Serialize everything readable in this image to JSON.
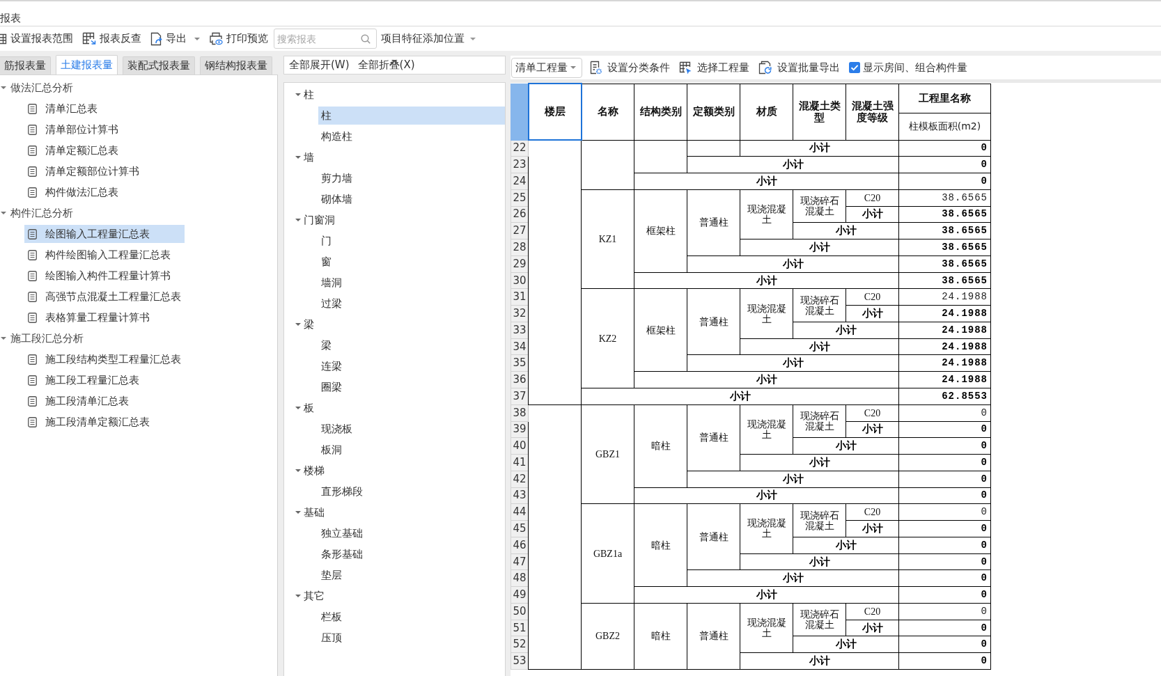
{
  "window": {
    "title": "报表"
  },
  "toolbar": {
    "items": [
      {
        "kind": "button",
        "label": "设置报表范围"
      },
      {
        "kind": "button",
        "label": "报表反查"
      },
      {
        "kind": "menu_button",
        "label": "导出"
      },
      {
        "kind": "button",
        "label": "打印预览"
      },
      {
        "kind": "search",
        "placeholder": "搜索报表"
      },
      {
        "kind": "dropdown",
        "label": "项目特征添加位置"
      }
    ]
  },
  "report_tabs": [
    {
      "label": "筋报表量",
      "selected": false
    },
    {
      "label": "土建报表量",
      "selected": true
    },
    {
      "label": "装配式报表量",
      "selected": false
    },
    {
      "label": "钢结构报表量",
      "selected": false
    }
  ],
  "report_tree": [
    {
      "label": "做法汇总分析",
      "expanded": true,
      "children": [
        {
          "label": "清单汇总表",
          "selected": false
        },
        {
          "label": "清单部位计算书",
          "selected": false
        },
        {
          "label": "清单定额汇总表",
          "selected": false
        },
        {
          "label": "清单定额部位计算书",
          "selected": false
        },
        {
          "label": "构件做法汇总表",
          "selected": false
        }
      ]
    },
    {
      "label": "构件汇总分析",
      "expanded": true,
      "children": [
        {
          "label": "绘图输入工程量汇总表",
          "selected": true
        },
        {
          "label": "构件绘图输入工程量汇总表",
          "selected": false
        },
        {
          "label": "绘图输入构件工程量计算书",
          "selected": false
        },
        {
          "label": "高强节点混凝土工程量汇总表",
          "selected": false
        },
        {
          "label": "表格算量工程量计算书",
          "selected": false
        }
      ]
    },
    {
      "label": "施工段汇总分析",
      "expanded": true,
      "children": [
        {
          "label": "施工段结构类型工程量汇总表",
          "selected": false
        },
        {
          "label": "施工段工程量汇总表",
          "selected": false
        },
        {
          "label": "施工段清单汇总表",
          "selected": false
        },
        {
          "label": "施工段清单定额汇总表",
          "selected": false
        }
      ]
    }
  ],
  "component_panel": {
    "actions": [
      "全部展开(W)",
      "全部折叠(X)"
    ],
    "tree": [
      {
        "label": "柱",
        "expanded": true,
        "children": [
          {
            "label": "柱",
            "selected": true
          },
          {
            "label": "构造柱",
            "selected": false
          }
        ]
      },
      {
        "label": "墙",
        "expanded": true,
        "children": [
          {
            "label": "剪力墙",
            "selected": false
          },
          {
            "label": "砌体墙",
            "selected": false
          }
        ]
      },
      {
        "label": "门窗洞",
        "expanded": true,
        "children": [
          {
            "label": "门",
            "selected": false
          },
          {
            "label": "窗",
            "selected": false
          },
          {
            "label": "墙洞",
            "selected": false
          },
          {
            "label": "过梁",
            "selected": false
          }
        ]
      },
      {
        "label": "梁",
        "expanded": true,
        "children": [
          {
            "label": "梁",
            "selected": false
          },
          {
            "label": "连梁",
            "selected": false
          },
          {
            "label": "圈梁",
            "selected": false
          }
        ]
      },
      {
        "label": "板",
        "expanded": true,
        "children": [
          {
            "label": "现浇板",
            "selected": false
          },
          {
            "label": "板洞",
            "selected": false
          }
        ]
      },
      {
        "label": "楼梯",
        "expanded": true,
        "children": [
          {
            "label": "直形梯段",
            "selected": false
          }
        ]
      },
      {
        "label": "基础",
        "expanded": true,
        "children": [
          {
            "label": "独立基础",
            "selected": false
          },
          {
            "label": "条形基础",
            "selected": false
          },
          {
            "label": "垫层",
            "selected": false
          }
        ]
      },
      {
        "label": "其它",
        "expanded": true,
        "children": [
          {
            "label": "栏板",
            "selected": false
          },
          {
            "label": "压顶",
            "selected": false
          }
        ]
      }
    ]
  },
  "quantity_toolbar": {
    "mode": {
      "value": "清单工程量"
    },
    "buttons": [
      "设置分类条件",
      "选择工程量",
      "设置批量导出"
    ],
    "show_rooms": {
      "label": "显示房间、组合构件量",
      "checked": true
    }
  },
  "table": {
    "columns": [
      {
        "label": "楼层",
        "selected": true
      },
      {
        "label": "名称",
        "selected": false
      },
      {
        "label": "结构类别",
        "selected": false
      },
      {
        "label": "定额类别",
        "selected": false
      },
      {
        "label": "材质",
        "selected": false
      },
      {
        "label": "混凝土类型",
        "selected": false
      },
      {
        "label": "混凝土强度等级",
        "selected": false
      }
    ],
    "quantity_header": "工程里名称",
    "quantity_column": "柱模板面积(m2)",
    "row_numbers": [
      "22",
      "23",
      "24",
      "25",
      "26",
      "27",
      "28",
      "29",
      "30",
      "31",
      "32",
      "33",
      "34",
      "35",
      "36",
      "37",
      "38",
      "39",
      "40",
      "41",
      "42",
      "43",
      "44",
      "45",
      "46",
      "47",
      "48",
      "49",
      "50",
      "51",
      "52",
      "53"
    ],
    "groups": [
      {
        "children": [
          {
            "children": [
              {
                "children": [
                  {
                    "subtotal": {
                      "label": "小计",
                      "value": "0"
                    }
                  }
                ],
                "subtotal": {
                  "label": "小计",
                  "value": "0"
                }
              }
            ],
            "subtotal": {
              "label": "小计",
              "value": "0"
            }
          },
          {
            "text": "KZ1",
            "children": [
              {
                "text": "框架柱",
                "children": [
                  {
                    "text": "普通柱",
                    "children": [
                      {
                        "text": "现浇混凝土",
                        "children": [
                          {
                            "text": "现浇碎石混凝土",
                            "children": [
                              {
                                "text": "C20",
                                "value": "38.6565"
                              }
                            ],
                            "subtotal": {
                              "label": "小计",
                              "value": "38.6565"
                            }
                          }
                        ],
                        "subtotal": {
                          "label": "小计",
                          "value": "38.6565"
                        }
                      }
                    ],
                    "subtotal": {
                      "label": "小计",
                      "value": "38.6565"
                    }
                  }
                ],
                "subtotal": {
                  "label": "小计",
                  "value": "38.6565"
                }
              }
            ],
            "subtotal": {
              "label": "小计",
              "value": "38.6565"
            }
          },
          {
            "text": "KZ2",
            "children": [
              {
                "text": "框架柱",
                "children": [
                  {
                    "text": "普通柱",
                    "children": [
                      {
                        "text": "现浇混凝土",
                        "children": [
                          {
                            "text": "现浇碎石混凝土",
                            "children": [
                              {
                                "text": "C20",
                                "value": "24.1988"
                              }
                            ],
                            "subtotal": {
                              "label": "小计",
                              "value": "24.1988"
                            }
                          }
                        ],
                        "subtotal": {
                          "label": "小计",
                          "value": "24.1988"
                        }
                      }
                    ],
                    "subtotal": {
                      "label": "小计",
                      "value": "24.1988"
                    }
                  }
                ],
                "subtotal": {
                  "label": "小计",
                  "value": "24.1988"
                }
              }
            ],
            "subtotal": {
              "label": "小计",
              "value": "24.1988"
            }
          }
        ],
        "subtotal": {
          "label": "小计",
          "value": "62.8553"
        }
      },
      {
        "children": [
          {
            "text": "GBZ1",
            "children": [
              {
                "text": "暗柱",
                "children": [
                  {
                    "text": "普通柱",
                    "children": [
                      {
                        "text": "现浇混凝土",
                        "children": [
                          {
                            "text": "现浇碎石混凝土",
                            "children": [
                              {
                                "text": "C20",
                                "value": "0"
                              }
                            ],
                            "subtotal": {
                              "label": "小计",
                              "value": "0"
                            }
                          }
                        ],
                        "subtotal": {
                          "label": "小计",
                          "value": "0"
                        }
                      }
                    ],
                    "subtotal": {
                      "label": "小计",
                      "value": "0"
                    }
                  }
                ],
                "subtotal": {
                  "label": "小计",
                  "value": "0"
                }
              }
            ],
            "subtotal": {
              "label": "小计",
              "value": "0"
            }
          },
          {
            "text": "GBZ1a",
            "children": [
              {
                "text": "暗柱",
                "children": [
                  {
                    "text": "普通柱",
                    "children": [
                      {
                        "text": "现浇混凝土",
                        "children": [
                          {
                            "text": "现浇碎石混凝土",
                            "children": [
                              {
                                "text": "C20",
                                "value": "0"
                              }
                            ],
                            "subtotal": {
                              "label": "小计",
                              "value": "0"
                            }
                          }
                        ],
                        "subtotal": {
                          "label": "小计",
                          "value": "0"
                        }
                      }
                    ],
                    "subtotal": {
                      "label": "小计",
                      "value": "0"
                    }
                  }
                ],
                "subtotal": {
                  "label": "小计",
                  "value": "0"
                }
              }
            ],
            "subtotal": {
              "label": "小计",
              "value": "0"
            }
          },
          {
            "text": "GBZ2",
            "children": [
              {
                "text": "暗柱",
                "children": [
                  {
                    "text": "普通柱",
                    "children": [
                      {
                        "text": "现浇混凝土",
                        "children": [
                          {
                            "text": "现浇碎石混凝土",
                            "children": [
                              {
                                "text": "C20",
                                "value": "0"
                              }
                            ],
                            "subtotal": {
                              "label": "小计",
                              "value": "0"
                            }
                          }
                        ],
                        "subtotal": {
                          "label": "小计",
                          "value": "0"
                        }
                      }
                    ],
                    "subtotal": {
                      "label": "小计",
                      "value": "0"
                    }
                  }
                ]
              }
            ]
          }
        ]
      }
    ]
  }
}
